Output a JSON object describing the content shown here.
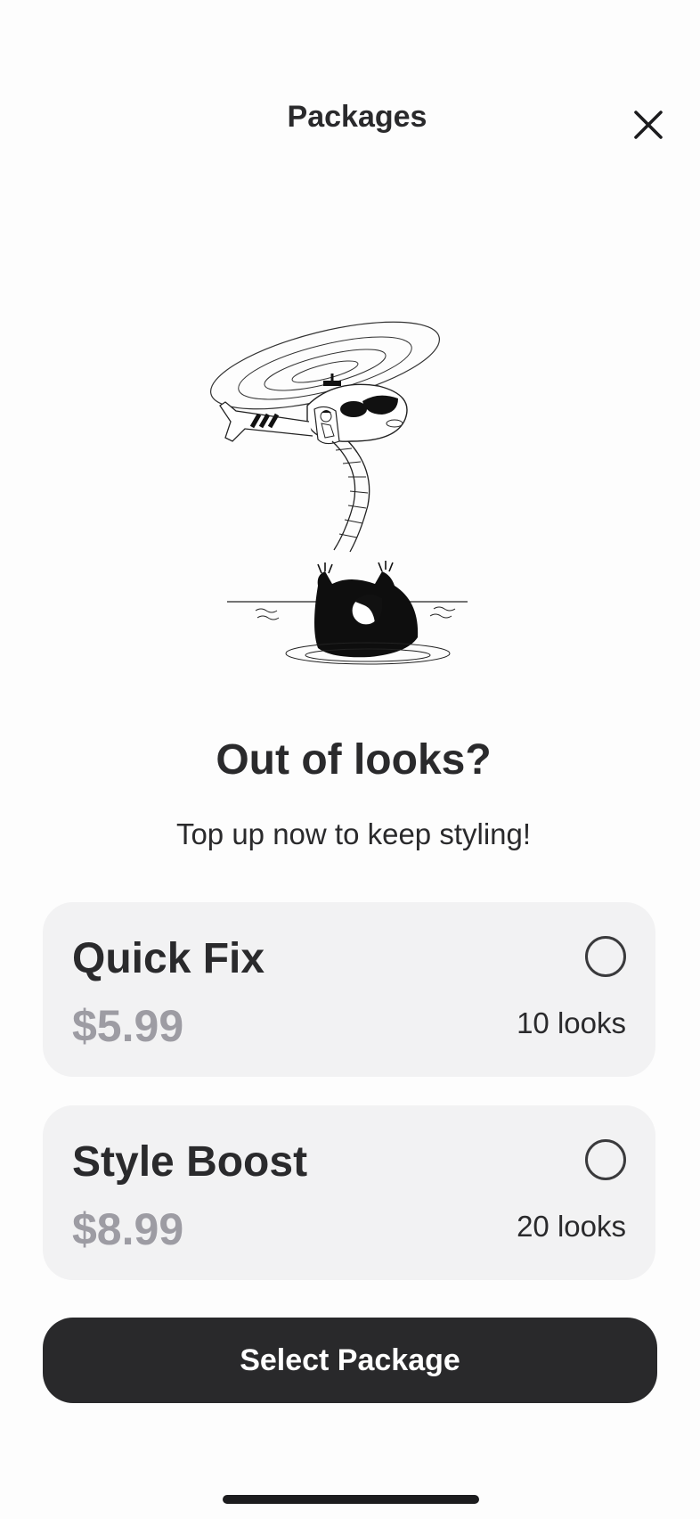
{
  "header": {
    "title": "Packages",
    "close_icon": "close-icon"
  },
  "hero": {
    "illustration": "helicopter-rescue-illustration",
    "headline": "Out of looks?",
    "subline": "Top up now to keep styling!"
  },
  "packages": [
    {
      "name": "Quick Fix",
      "price": "$5.99",
      "looks": "10 looks",
      "selected": false
    },
    {
      "name": "Style Boost",
      "price": "$8.99",
      "looks": "20 looks",
      "selected": false
    }
  ],
  "cta": {
    "label": "Select Package"
  },
  "colors": {
    "background": "#fdfdfd",
    "card": "#f2f2f3",
    "price": "#9d9ca3",
    "button": "#29292b",
    "text": "#2a2a2c"
  }
}
